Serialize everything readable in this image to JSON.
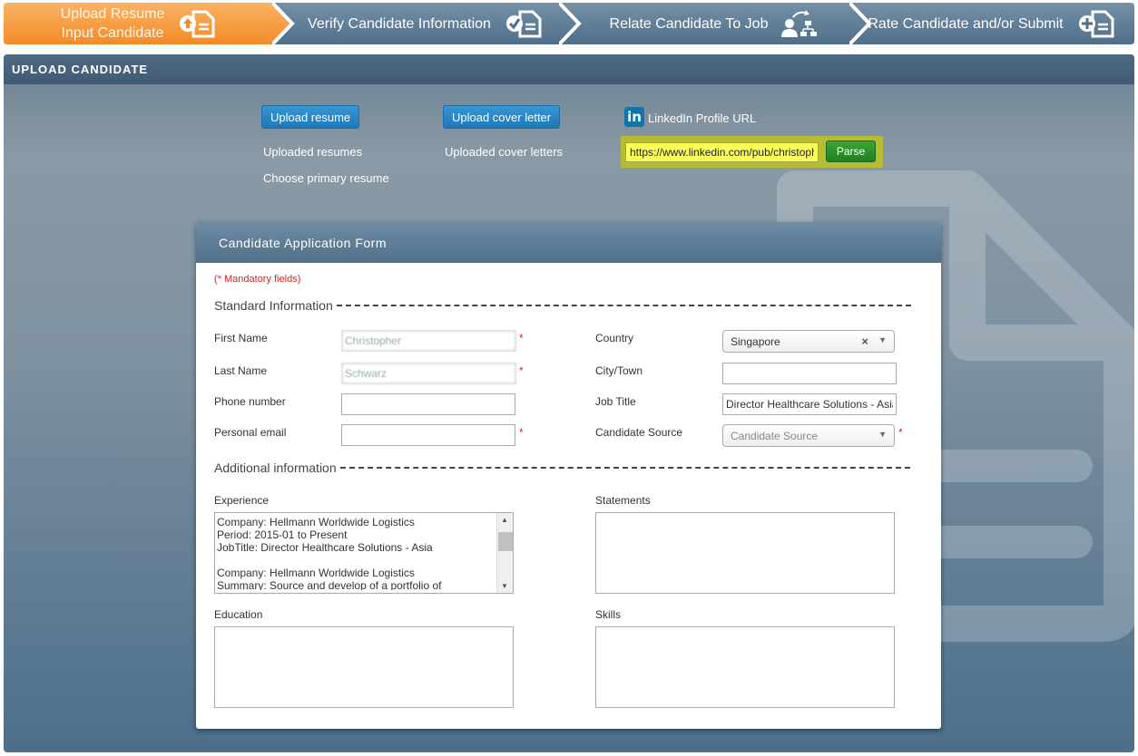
{
  "wizard": {
    "steps": [
      {
        "label_line1": "Upload Resume",
        "label_line2": "Input Candidate",
        "icon": "document-upload-icon",
        "color": "#f7a14a"
      },
      {
        "label_line1": "Verify Candidate Information",
        "icon": "document-check-icon"
      },
      {
        "label_line1": "Relate Candidate To Job",
        "icon": "person-hierarchy-icon"
      },
      {
        "label_line1": "Rate Candidate and/or Submit",
        "icon": "document-add-icon"
      }
    ]
  },
  "panel": {
    "title": "UPLOAD CANDIDATE"
  },
  "upload": {
    "resume_button": "Upload resume",
    "uploaded_resumes": "Uploaded resumes",
    "choose_primary": "Choose primary resume",
    "cover_button": "Upload cover letter",
    "uploaded_covers": "Uploaded cover letters",
    "linkedin_logo": "in",
    "linkedin_label": "LinkedIn Profile URL",
    "linkedin_value": "https://www.linkedin.com/pub/christopher",
    "parse_button": "Parse"
  },
  "form": {
    "title": "Candidate Application Form",
    "mandatory_note": "(* Mandatory fields)",
    "required_mark": "*",
    "standard_section": "Standard Information",
    "additional_section": "Additional information",
    "first_name": {
      "label": "First Name",
      "value": "Christopher"
    },
    "last_name": {
      "label": "Last Name",
      "value": "Schwarz"
    },
    "phone": {
      "label": "Phone number",
      "value": ""
    },
    "email": {
      "label": "Personal email",
      "value": ""
    },
    "country": {
      "label": "Country",
      "value": "Singapore",
      "clear": "×",
      "arrow": "▼"
    },
    "city": {
      "label": "City/Town",
      "value": ""
    },
    "job_title": {
      "label": "Job Title",
      "value": "Director Healthcare Solutions - Asia"
    },
    "source": {
      "label": "Candidate Source",
      "value": "Candidate Source",
      "arrow": "▼"
    },
    "experience": {
      "label": "Experience",
      "value": "Company: Hellmann Worldwide Logistics\nPeriod: 2015-01 to Present\nJobTitle: Director Healthcare Solutions - Asia\n\nCompany: Hellmann Worldwide Logistics\nSummary: Source and develop of a portfolio of",
      "scroll_up": "▲",
      "scroll_down": "▼"
    },
    "statements": {
      "label": "Statements"
    },
    "education": {
      "label": "Education"
    },
    "skills": {
      "label": "Skills"
    }
  }
}
